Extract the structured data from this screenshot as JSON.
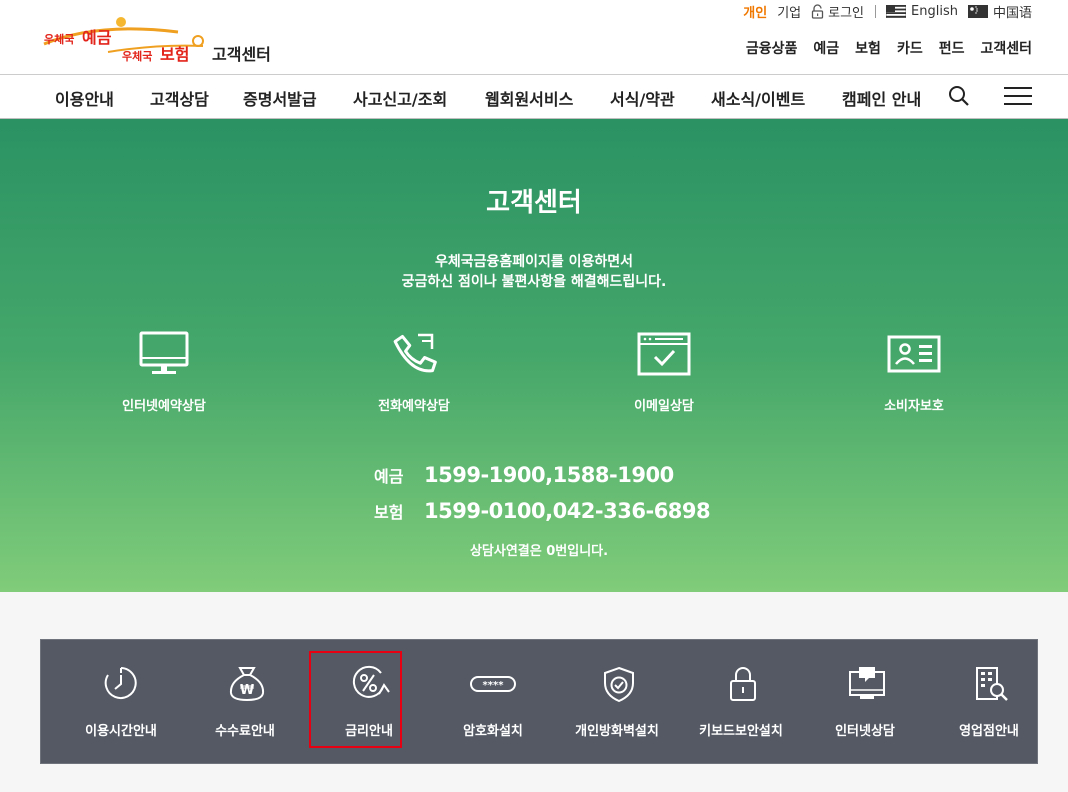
{
  "header": {
    "logo": {
      "brand_deposit": "우체국 예금",
      "brand_insurance": "우체국 보험",
      "brand_deposit_small": "우체국",
      "brand_deposit_big": "예금",
      "brand_insurance_small": "우체국",
      "brand_insurance_big": "보험",
      "title": "고객센터"
    },
    "util": {
      "personal": "개인",
      "corporate": "기업",
      "login": "로그인",
      "english": "English",
      "chinese": "中国语"
    },
    "sitelinks": [
      "금융상품",
      "예금",
      "보험",
      "카드",
      "펀드",
      "고객센터"
    ]
  },
  "gnb": {
    "items": [
      "이용안내",
      "고객상담",
      "증명서발급",
      "사고신고/조회",
      "웹회원서비스",
      "서식/약관",
      "새소식/이벤트",
      "캠페인 안내"
    ],
    "search_icon": "search-icon",
    "menu_icon": "hamburger-menu-icon"
  },
  "hero": {
    "title": "고객센터",
    "desc_line1": "우체국금융홈페이지를 이용하면서",
    "desc_line2": "궁금하신 점이나 불편사항을 해결해드립니다.",
    "channels": [
      {
        "label": "인터넷예약상담",
        "icon": "monitor-icon"
      },
      {
        "label": "전화예약상담",
        "icon": "phone-icon"
      },
      {
        "label": "이메일상담",
        "icon": "email-icon"
      },
      {
        "label": "소비자보호",
        "icon": "id-card-icon"
      }
    ],
    "phones": [
      {
        "label": "예금",
        "number": "1599-1900,1588-1900"
      },
      {
        "label": "보험",
        "number": "1599-0100,042-336-6898"
      }
    ],
    "note": "상담사연결은 0번입니다."
  },
  "quick": {
    "items": [
      {
        "label": "이용시간안내",
        "icon": "clock-icon"
      },
      {
        "label": "수수료안내",
        "icon": "money-bag-icon"
      },
      {
        "label": "금리안내",
        "icon": "interest-rate-icon"
      },
      {
        "label": "암호화설치",
        "icon": "password-icon"
      },
      {
        "label": "개인방화벽설치",
        "icon": "shield-icon"
      },
      {
        "label": "키보드보안설치",
        "icon": "lock-icon"
      },
      {
        "label": "인터넷상담",
        "icon": "chat-monitor-icon"
      },
      {
        "label": "영업점안내",
        "icon": "building-search-icon"
      }
    ],
    "selected": "금리안내"
  },
  "colors": {
    "accent_orange": "#f07800",
    "hero_top": "#2a9263",
    "hero_bottom": "#80cc7a",
    "quick_bg": "#545964",
    "highlight": "#e60012"
  }
}
